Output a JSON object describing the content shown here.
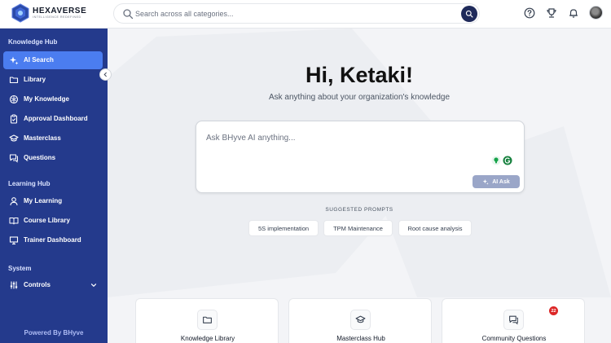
{
  "brand": {
    "name": "HEXAVERSE",
    "tagline": "INTELLIGENCE REDEFINED"
  },
  "search": {
    "placeholder": "Search across all categories...",
    "value": ""
  },
  "header_icons": [
    "help-icon",
    "trophy-icon",
    "bell-icon",
    "avatar"
  ],
  "sidebar": {
    "sections": [
      {
        "title": "Knowledge Hub"
      },
      {
        "title": "Learning Hub"
      },
      {
        "title": "System"
      }
    ],
    "items": [
      {
        "label": "AI Search",
        "icon": "sparkle-icon",
        "active": true
      },
      {
        "label": "Library",
        "icon": "folder-icon"
      },
      {
        "label": "My Knowledge",
        "icon": "brain-icon"
      },
      {
        "label": "Approval Dashboard",
        "icon": "clipboard-check-icon"
      },
      {
        "label": "Masterclass",
        "icon": "graduation-cap-icon"
      },
      {
        "label": "Questions",
        "icon": "chat-icon"
      },
      {
        "label": "My Learning",
        "icon": "user-icon"
      },
      {
        "label": "Course Library",
        "icon": "book-open-icon"
      },
      {
        "label": "Trainer Dashboard",
        "icon": "presentation-icon"
      },
      {
        "label": "Controls",
        "icon": "sliders-icon",
        "expandable": true
      }
    ],
    "footer": "Powered By BHyve"
  },
  "main": {
    "greeting": "Hi, Ketaki!",
    "subtitle": "Ask anything about your organization's knowledge",
    "ask": {
      "placeholder": "Ask BHyve AI anything...",
      "value": "",
      "button_label": "AI Ask"
    },
    "suggested_title": "SUGGESTED PROMPTS",
    "prompts": [
      "5S implementation",
      "TPM Maintenance",
      "Root cause analysis"
    ],
    "cards": [
      {
        "label": "Knowledge Library",
        "icon": "folder-icon"
      },
      {
        "label": "Masterclass Hub",
        "icon": "graduation-cap-icon"
      },
      {
        "label": "Community Questions",
        "icon": "chat-icon",
        "badge": "22"
      }
    ]
  },
  "colors": {
    "sidebar": "#243a8c",
    "active": "#4b7df0",
    "primary_dark": "#1f2a5a",
    "badge": "#dc2626"
  }
}
